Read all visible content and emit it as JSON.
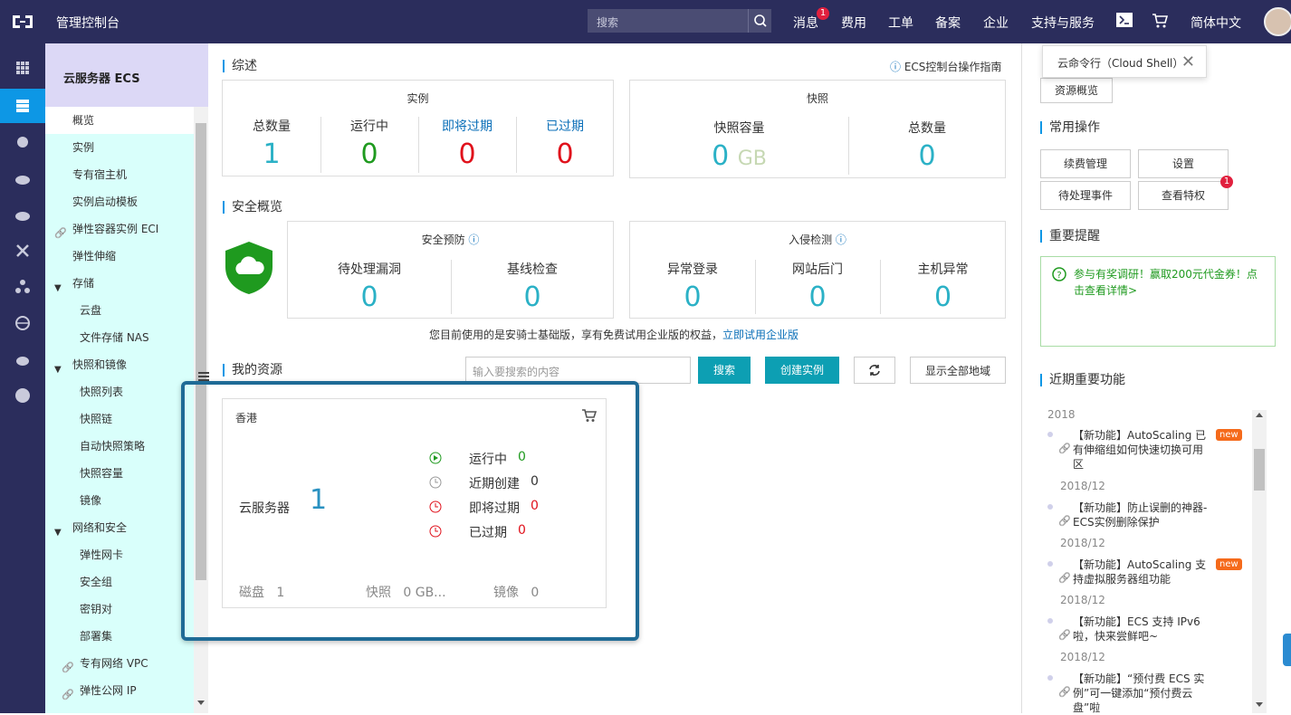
{
  "topbar": {
    "brand": "管理控制台",
    "search_placeholder": "搜索",
    "nav": [
      {
        "label": "消息",
        "badge": "1"
      },
      {
        "label": "费用"
      },
      {
        "label": "工单"
      },
      {
        "label": "备案"
      },
      {
        "label": "企业"
      },
      {
        "label": "支持与服务"
      },
      {
        "label": "简体中文"
      }
    ]
  },
  "sidebar": {
    "header": "云服务器 ECS",
    "items": [
      {
        "label": "概览"
      },
      {
        "label": "实例"
      },
      {
        "label": "专有宿主机"
      },
      {
        "label": "实例启动模板"
      },
      {
        "label": "弹性容器实例 ECI"
      },
      {
        "label": "弹性伸缩"
      },
      {
        "label": "存储"
      },
      {
        "label": "云盘"
      },
      {
        "label": "文件存储 NAS"
      },
      {
        "label": "快照和镜像"
      },
      {
        "label": "快照列表"
      },
      {
        "label": "快照链"
      },
      {
        "label": "自动快照策略"
      },
      {
        "label": "快照容量"
      },
      {
        "label": "镜像"
      },
      {
        "label": "网络和安全"
      },
      {
        "label": "弹性网卡"
      },
      {
        "label": "安全组"
      },
      {
        "label": "密钥对"
      },
      {
        "label": "部署集"
      },
      {
        "label": "专有网络 VPC"
      },
      {
        "label": "弹性公网 IP"
      }
    ]
  },
  "overview": {
    "title": "综述",
    "guide_link": "ECS控制台操作指南",
    "instances": {
      "title": "实例",
      "total_label": "总数量",
      "total": "1",
      "running_label": "运行中",
      "running": "0",
      "expiring_label": "即将过期",
      "expiring": "0",
      "expired_label": "已过期",
      "expired": "0"
    },
    "snapshots": {
      "title": "快照",
      "capacity_label": "快照容量",
      "capacity": "0",
      "capacity_unit": "GB",
      "total_label": "总数量",
      "total": "0"
    }
  },
  "security": {
    "title": "安全概览",
    "warning": {
      "title": "安全预防",
      "vuln_label": "待处理漏洞",
      "vuln": "0",
      "baseline_label": "基线检查",
      "baseline": "0"
    },
    "intrusion": {
      "title": "入侵检测",
      "login_label": "异常登录",
      "login": "0",
      "backdoor_label": "网站后门",
      "backdoor": "0",
      "host_label": "主机异常",
      "host": "0"
    },
    "note": "您目前使用的是安骑士基础版，享有免费试用企业版的权益，",
    "note_link": "立即试用企业版"
  },
  "resources": {
    "title": "我的资源",
    "search_placeholder": "输入要搜索的内容",
    "search_btn": "搜索",
    "create_btn": "创建实例",
    "show_all_btn": "显示全部地域",
    "card": {
      "region": "香港",
      "server_label": "云服务器",
      "server_count": "1",
      "running_label": "运行中",
      "running": "0",
      "recent_label": "近期创建",
      "recent": "0",
      "expiring_label": "即将过期",
      "expiring": "0",
      "expired_label": "已过期",
      "expired": "0",
      "disk_label": "磁盘",
      "disk": "1",
      "snapshot_label": "快照",
      "snapshot": "0 GB...",
      "image_label": "镜像",
      "image": "0"
    }
  },
  "right": {
    "tooltip": "云命令行（Cloud Shell）",
    "resource_overview_btn": "资源概览",
    "common_title": "常用操作",
    "common_ops": [
      "续费管理",
      "设置",
      "待处理事件",
      "查看特权"
    ],
    "privilege_badge": "1",
    "reminder_title": "重要提醒",
    "reminder_text": "参与有奖调研！赢取200元代金券！点击查看详情>",
    "features_title": "近期重要功能",
    "features": [
      {
        "date": "2018",
        "text1": "【新功能】AutoScaling 已",
        "text2": "有伸缩组如何快速切换可用",
        "text3": "区",
        "new": "new"
      },
      {
        "date": "2018/12",
        "text1": "【新功能】防止误删的神器-",
        "text2": "ECS实例删除保护"
      },
      {
        "date": "2018/12",
        "text1": "【新功能】AutoScaling 支",
        "text2": "持虚拟服务器组功能",
        "new": "new"
      },
      {
        "date": "2018/12",
        "text1": "【新功能】ECS 支持 IPv6",
        "text2": "啦，快来尝鲜吧~"
      },
      {
        "date": "2018/12",
        "text1": "【新功能】“预付费 ECS 实",
        "text2": "例”可一键添加“预付费云",
        "text3": "盘”啦"
      }
    ]
  }
}
